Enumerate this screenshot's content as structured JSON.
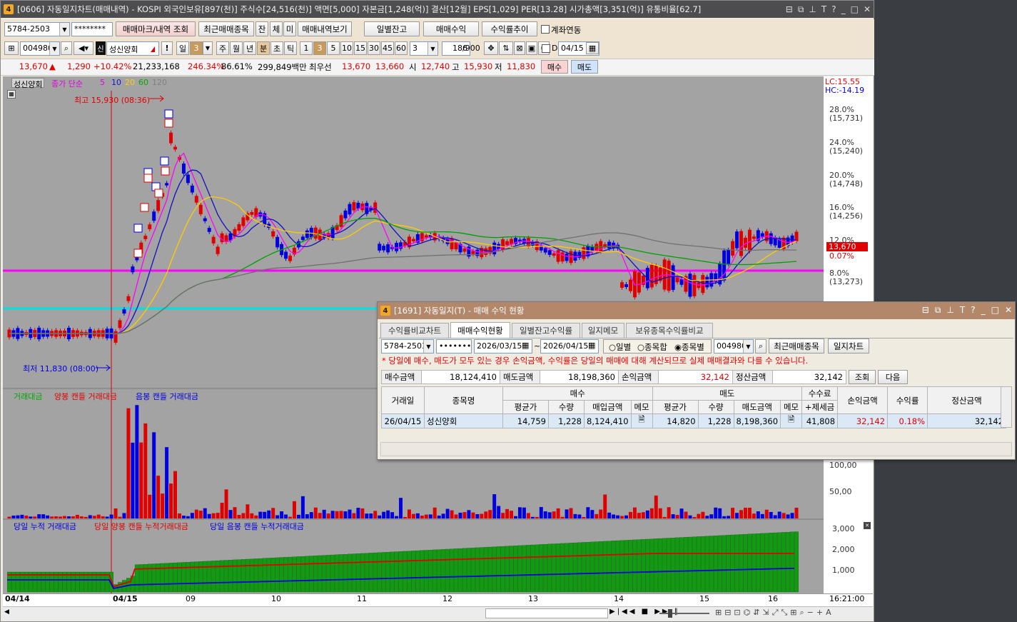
{
  "window": {
    "title": "[0606] 자동일지차트(매매내역) - KOSPI 외국인보유[897(천)] 주식수[24,516(천)] 액면[5,000] 자본금[1,248(억)] 결산[12월] EPS[1,029] PER[13.28] 시가총액[3,351(억)] 유통비율[62.7]",
    "icon": "4"
  },
  "toolbar1": {
    "account": "5784-2503",
    "password": "********",
    "btn_marks": "매매마크/내역 조회",
    "btn_recent": "최근매매종목",
    "btn_jan": "잔",
    "btn_che": "체",
    "btn_mi": "미",
    "btn_history": "매매내역보기",
    "btn_daily_balance": "일별잔고",
    "btn_trade_profit": "매매수익",
    "btn_return": "수익률추이",
    "chk_link": "계좌연동"
  },
  "toolbar2": {
    "code": "004980",
    "badge": "신",
    "stock_name": "성신양회",
    "unit_day": "일",
    "unit_n": "3",
    "week": "주",
    "month": "월",
    "year": "년",
    "min": "분",
    "sec": "초",
    "tick": "틱",
    "p1": "1",
    "p3": "3",
    "p5": "5",
    "p10": "10",
    "p15": "15",
    "p30": "30",
    "p45": "45",
    "p60": "60",
    "interval": "3",
    "count": "186",
    "total": "/900",
    "date": "04/15",
    "chk_d": "D"
  },
  "quote": {
    "price": "13,670",
    "arrow": "▲",
    "change": "1,290",
    "rate": "+10.42%",
    "volume": "21,233,168",
    "vol_ratio": "246.34%",
    "ratio2": "86.61%",
    "amount": "299,849백만",
    "pref_label": "최우선",
    "ask": "13,670",
    "bid": "13,660",
    "open_lbl": "시",
    "open": "12,740",
    "high_lbl": "고",
    "high": "15,930",
    "low_lbl": "저",
    "low": "11,830",
    "buy": "매수",
    "sell": "매도"
  },
  "chart": {
    "stock_label": "성신양회",
    "ma_label": "종가 단순",
    "ma": [
      "5",
      "10",
      "20",
      "60",
      "120"
    ],
    "ma_colors": [
      "#ff00ff",
      "#0000ff",
      "#ffd000",
      "#00aa00",
      "#808080"
    ],
    "high_label": "최고 15,930 (08:36)",
    "low_label": "최저 11,830 (08:00)",
    "lc": "LC:15.55",
    "hc": "HC:-14.19",
    "price_axis": [
      {
        "p": "28.0%",
        "v": "(15,731)"
      },
      {
        "p": "24.0%",
        "v": "(15,240)"
      },
      {
        "p": "20.0%",
        "v": "(14,748)"
      },
      {
        "p": "16.0%",
        "v": "(14,256)"
      },
      {
        "p": "12.0%",
        "v": ""
      },
      {
        "p": "8.0%",
        "v": "(13,273)"
      }
    ],
    "cur_price": "13,670",
    "cur_rate": "0.07%",
    "vol_legend": [
      "거래대금",
      "양봉 캔들 거래대금",
      "음봉 캔들 거래대금"
    ],
    "vol_axis": [
      "100,00",
      "50,00"
    ],
    "cum_legend": [
      "당일 누적 거래대금",
      "당일 양봉 캔들 누적거래대금",
      "당일 음봉 캔들 누적거래대금"
    ],
    "cum_axis": [
      "3,000",
      "2,000",
      "1,000"
    ],
    "x_labels": [
      "04/14",
      "04/15",
      "09",
      "10",
      "11",
      "12",
      "13",
      "14",
      "15",
      "16"
    ],
    "time": "16:21:00"
  },
  "popup": {
    "title": "[1691] 자동일지(T) - 매매 수익 현황",
    "icon": "4",
    "tabs": [
      "수익률비교차트",
      "매매수익현황",
      "일별잔고수익률",
      "일지메모",
      "보유종목수익률비교"
    ],
    "account": "5784-2503",
    "password": "•••••••••",
    "date_from": "2026/03/15",
    "date_to": "2026/04/15",
    "radio_daily": "일별",
    "radio_sum": "종목합",
    "radio_each": "종목별",
    "code": "004980",
    "btn_recent": "최근매매종목",
    "btn_chart": "일지차트",
    "notice": "* 당일에 매수, 매도가 모두 있는 경우 손익금액, 수익률은 당일의 매매에 대해 계산되므로 실제 매매결과와 다를 수 있습니다.",
    "summary": {
      "buy_lbl": "매수금액",
      "buy": "18,124,410",
      "sell_lbl": "매도금액",
      "sell": "18,198,360",
      "pl_lbl": "손익금액",
      "pl": "32,142",
      "settle_lbl": "정산금액",
      "settle": "32,142",
      "btn_query": "조회",
      "btn_next": "다음"
    },
    "headers": {
      "date": "거래일",
      "name": "종목명",
      "buy": "매수",
      "sell": "매도",
      "avg": "평균가",
      "qty": "수량",
      "buy_amt": "매입금액",
      "memo": "메모",
      "sell_amt": "매도금액",
      "fee": "수수료",
      "tax": "+제세금",
      "pl": "손익금액",
      "rate": "수익률",
      "settle": "정산금액"
    },
    "row": {
      "date": "26/04/15",
      "name": "성신양회",
      "b_avg": "14,759",
      "b_qty": "1,228",
      "b_amt": "8,124,410",
      "s_avg": "14,820",
      "s_qty": "1,228",
      "s_amt": "8,198,360",
      "fee": "41,808",
      "pl": "32,142",
      "rate": "0.18%",
      "settle": "32,142"
    }
  }
}
